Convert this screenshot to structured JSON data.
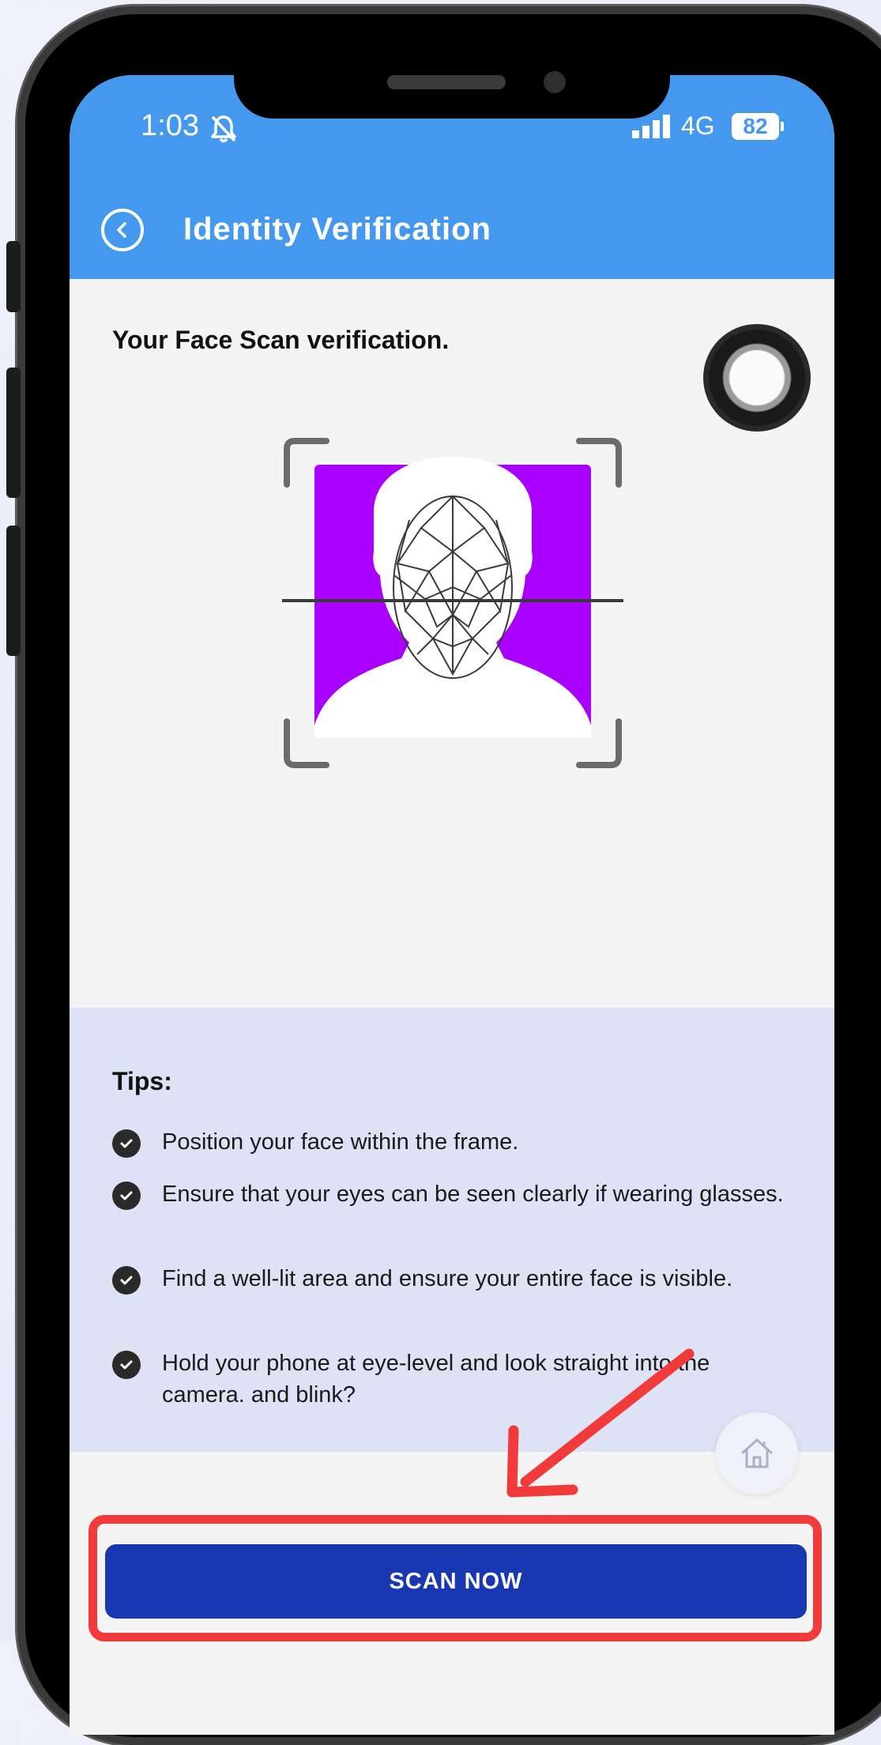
{
  "status_bar": {
    "time": "1:03",
    "network": "4G",
    "battery": "82"
  },
  "header": {
    "title": "Identity Verification"
  },
  "main": {
    "heading": "Your Face Scan verification."
  },
  "tips": {
    "title": "Tips:",
    "items": [
      "Position your face within the frame.",
      "Ensure that your eyes can be seen clearly if wearing glasses.",
      "Find a well-lit area and ensure your entire face is visible.",
      "Hold your phone at eye-level and look straight into the camera. and blink?"
    ]
  },
  "footer": {
    "scan_label": "SCAN NOW"
  },
  "colors": {
    "app_bar": "#4499ee",
    "face_background": "#aa00ff",
    "scan_button": "#1738b0",
    "annotation_red": "#f23a3a",
    "tips_background": "#dde2f5"
  },
  "icons": [
    "back-icon",
    "bell-muted-icon",
    "signal-icon",
    "check-icon",
    "home-icon",
    "face-mesh-icon"
  ]
}
